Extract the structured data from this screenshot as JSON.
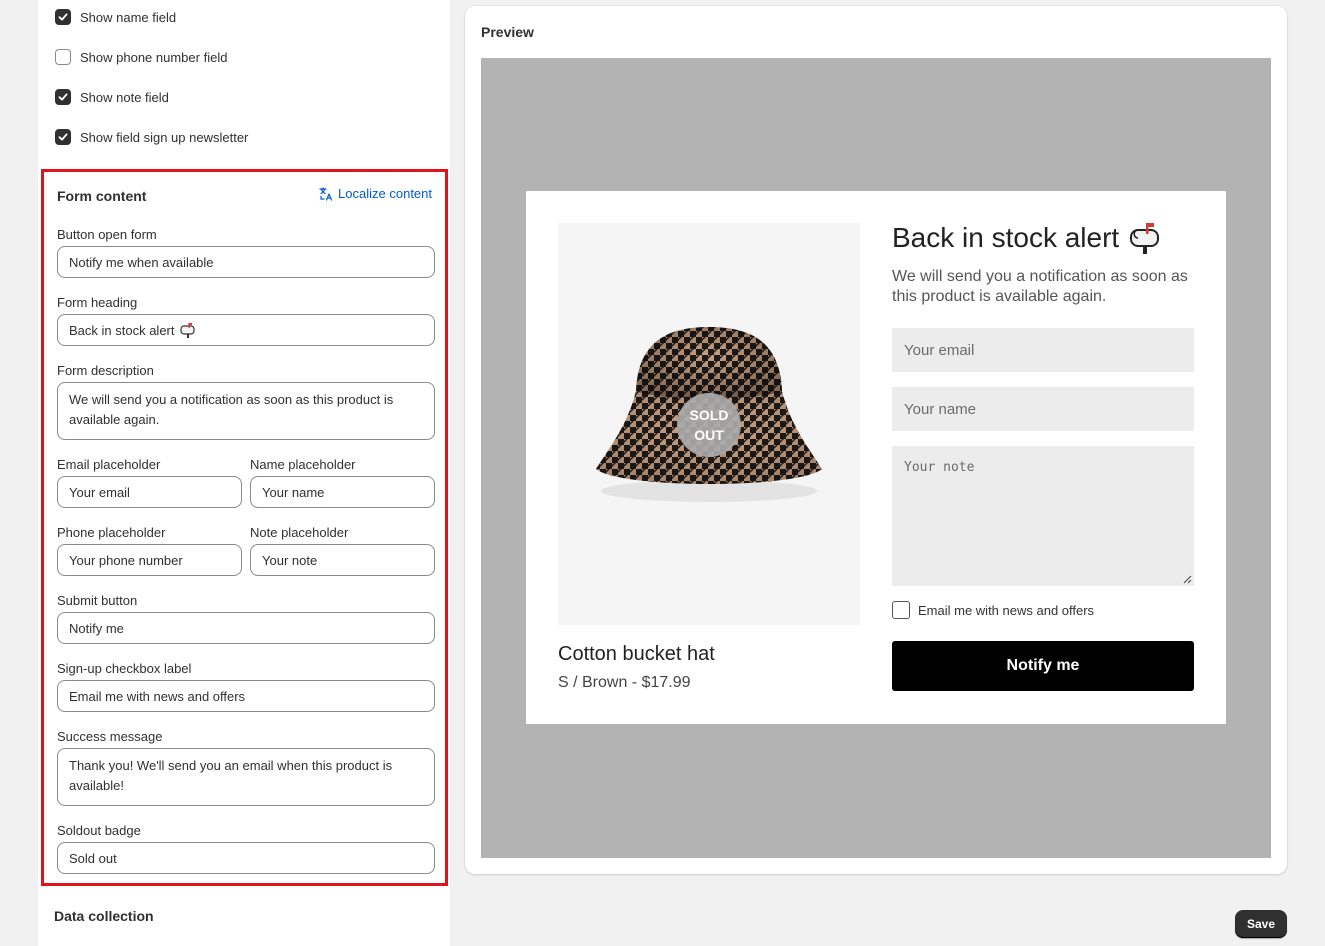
{
  "settings": {
    "checkboxes": [
      {
        "label": "Show name field",
        "checked": true
      },
      {
        "label": "Show phone number field",
        "checked": false
      },
      {
        "label": "Show note field",
        "checked": true
      },
      {
        "label": "Show field sign up newsletter",
        "checked": true
      }
    ]
  },
  "form_content": {
    "title": "Form content",
    "localize_label": "Localize content",
    "button_open_form": {
      "label": "Button open form",
      "value": "Notify me when available"
    },
    "form_heading": {
      "label": "Form heading",
      "value": "Back in stock alert"
    },
    "form_description": {
      "label": "Form description",
      "value": "We will send you a notification as soon as this product is available again."
    },
    "email_placeholder": {
      "label": "Email placeholder",
      "value": "Your email"
    },
    "name_placeholder": {
      "label": "Name placeholder",
      "value": "Your name"
    },
    "phone_placeholder": {
      "label": "Phone placeholder",
      "value": "Your phone number"
    },
    "note_placeholder": {
      "label": "Note placeholder",
      "value": "Your note"
    },
    "submit_button": {
      "label": "Submit button",
      "value": "Notify me"
    },
    "signup_checkbox": {
      "label": "Sign-up checkbox label",
      "value": "Email me with news and offers"
    },
    "success_message": {
      "label": "Success message",
      "value": "Thank you! We'll send you an email when this product is available!"
    },
    "soldout_badge": {
      "label": "Soldout badge",
      "value": "Sold out"
    }
  },
  "data_collection": {
    "title": "Data collection"
  },
  "preview": {
    "title": "Preview",
    "badge_line1": "SOLD",
    "badge_line2": "OUT",
    "product_name": "Cotton bucket hat",
    "product_variant": "S / Brown - $17.99",
    "heading": "Back in stock alert",
    "description": "We will send you a notification as soon as this product is available again.",
    "email_placeholder": "Your email",
    "name_placeholder": "Your name",
    "note_placeholder": "Your note",
    "checkbox_label": "Email me with news and offers",
    "submit_label": "Notify me"
  },
  "footer": {
    "save_label": "Save"
  },
  "colors": {
    "highlight_border": "#e0121b",
    "link": "#005bd3",
    "stage_bg": "#b3b3b3",
    "submit_bg": "#000000"
  },
  "icons": [
    "checkmark-icon",
    "translate-icon",
    "mailbox-icon",
    "resize-grip-icon"
  ]
}
